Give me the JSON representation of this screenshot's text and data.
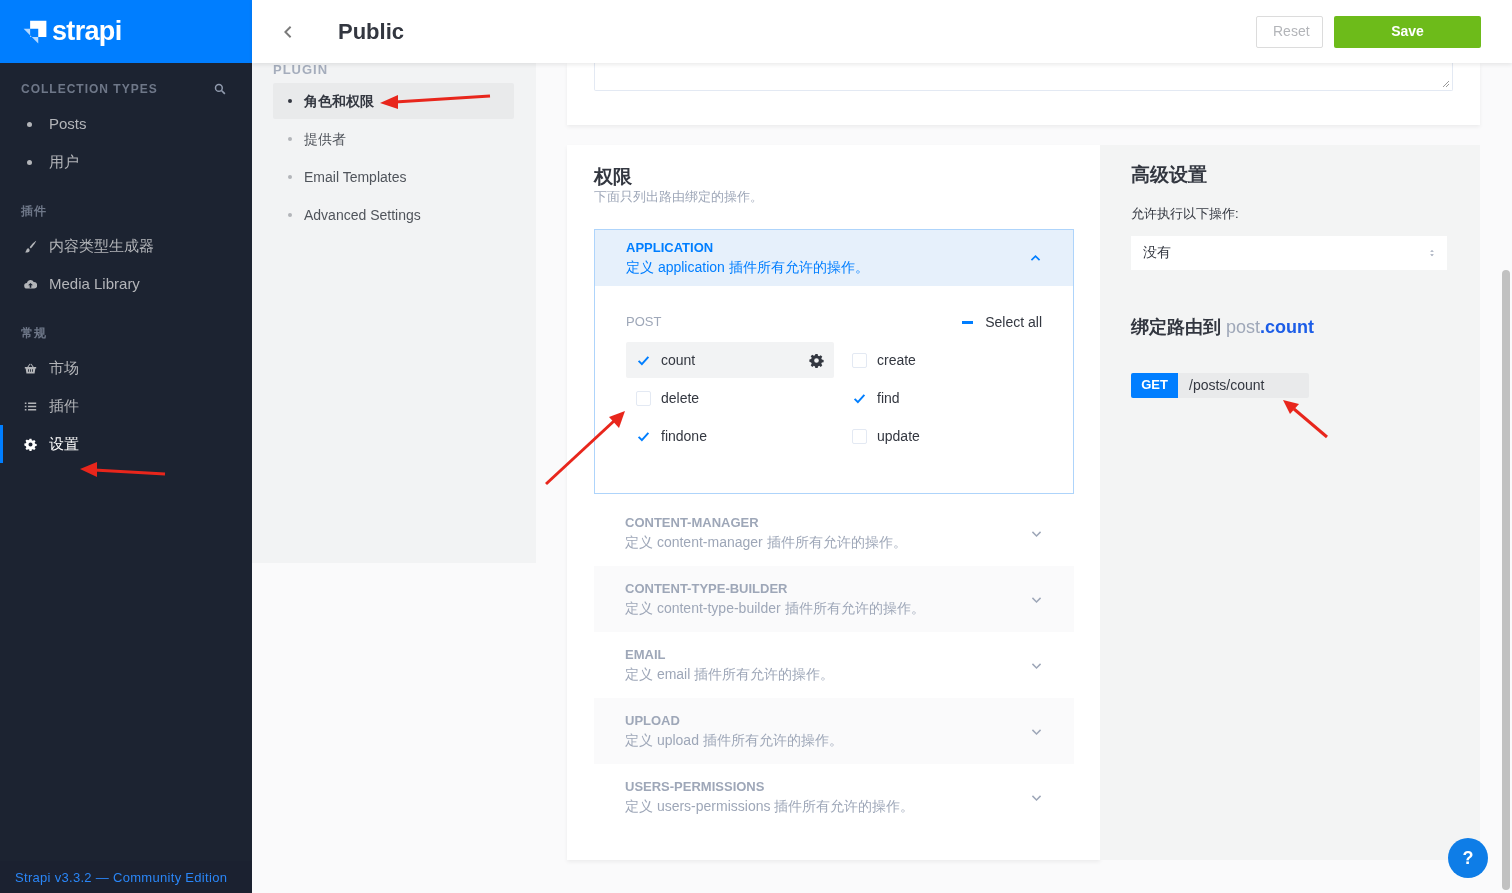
{
  "sidebar": {
    "logo": "strapi",
    "sections": [
      {
        "title": "COLLECTION TYPES",
        "search": true,
        "kind": "bullets",
        "items": [
          {
            "label": "Posts",
            "selected": false
          },
          {
            "label": "用户",
            "selected": false
          }
        ]
      },
      {
        "title": "插件",
        "search": false,
        "kind": "icons",
        "items": [
          {
            "label": "内容类型生成器",
            "selected": false
          },
          {
            "label": "Media Library",
            "selected": false
          }
        ]
      },
      {
        "title": "常规",
        "search": false,
        "kind": "icons",
        "items": [
          {
            "label": "市场",
            "selected": false
          },
          {
            "label": "插件",
            "selected": false
          },
          {
            "label": "设置",
            "selected": true
          }
        ]
      }
    ],
    "footer": "Strapi v3.3.2 — Community Edition"
  },
  "header": {
    "title": "Public",
    "buttons": [
      {
        "label": "Reset",
        "kind": "secondary"
      },
      {
        "label": "Save",
        "kind": "primary"
      }
    ]
  },
  "subnav": {
    "title": "PLUGIN",
    "items": [
      {
        "label": "角色和权限",
        "selected": true
      },
      {
        "label": "提供者",
        "selected": false
      },
      {
        "label": "Email Templates",
        "selected": false
      },
      {
        "label": "Advanced Settings",
        "selected": false
      }
    ]
  },
  "permissions": {
    "title": "权限",
    "subtitle": "下面只列出路由绑定的操作。",
    "plugins": [
      {
        "name": "APPLICATION",
        "description": "定义 application 插件所有允许的操作。",
        "expanded": true,
        "controllers": [
          {
            "name": "POST",
            "select_all": "Select all",
            "indeterminate": true,
            "actions": [
              {
                "label": "count",
                "checked": true,
                "selected": true
              },
              {
                "label": "create",
                "checked": false,
                "selected": false
              },
              {
                "label": "delete",
                "checked": false,
                "selected": false
              },
              {
                "label": "find",
                "checked": true,
                "selected": false
              },
              {
                "label": "findone",
                "checked": true,
                "selected": false
              },
              {
                "label": "update",
                "checked": false,
                "selected": false
              }
            ]
          }
        ]
      },
      {
        "name": "CONTENT-MANAGER",
        "description": "定义 content-manager 插件所有允许的操作。",
        "expanded": false
      },
      {
        "name": "CONTENT-TYPE-BUILDER",
        "description": "定义 content-type-builder 插件所有允许的操作。",
        "expanded": false
      },
      {
        "name": "EMAIL",
        "description": "定义 email 插件所有允许的操作。",
        "expanded": false
      },
      {
        "name": "UPLOAD",
        "description": "定义 upload 插件所有允许的操作。",
        "expanded": false
      },
      {
        "name": "USERS-PERMISSIONS",
        "description": "定义 users-permissions 插件所有允许的操作。",
        "expanded": false
      }
    ]
  },
  "advanced": {
    "title": "高级设置",
    "label": "允许执行以下操作:",
    "select_value": "没有",
    "route_title": "绑定路由到",
    "route_controller": "post",
    "route_separator": ".",
    "route_action": "count",
    "method": "GET",
    "path": "/posts/count"
  },
  "help_button": "?"
}
